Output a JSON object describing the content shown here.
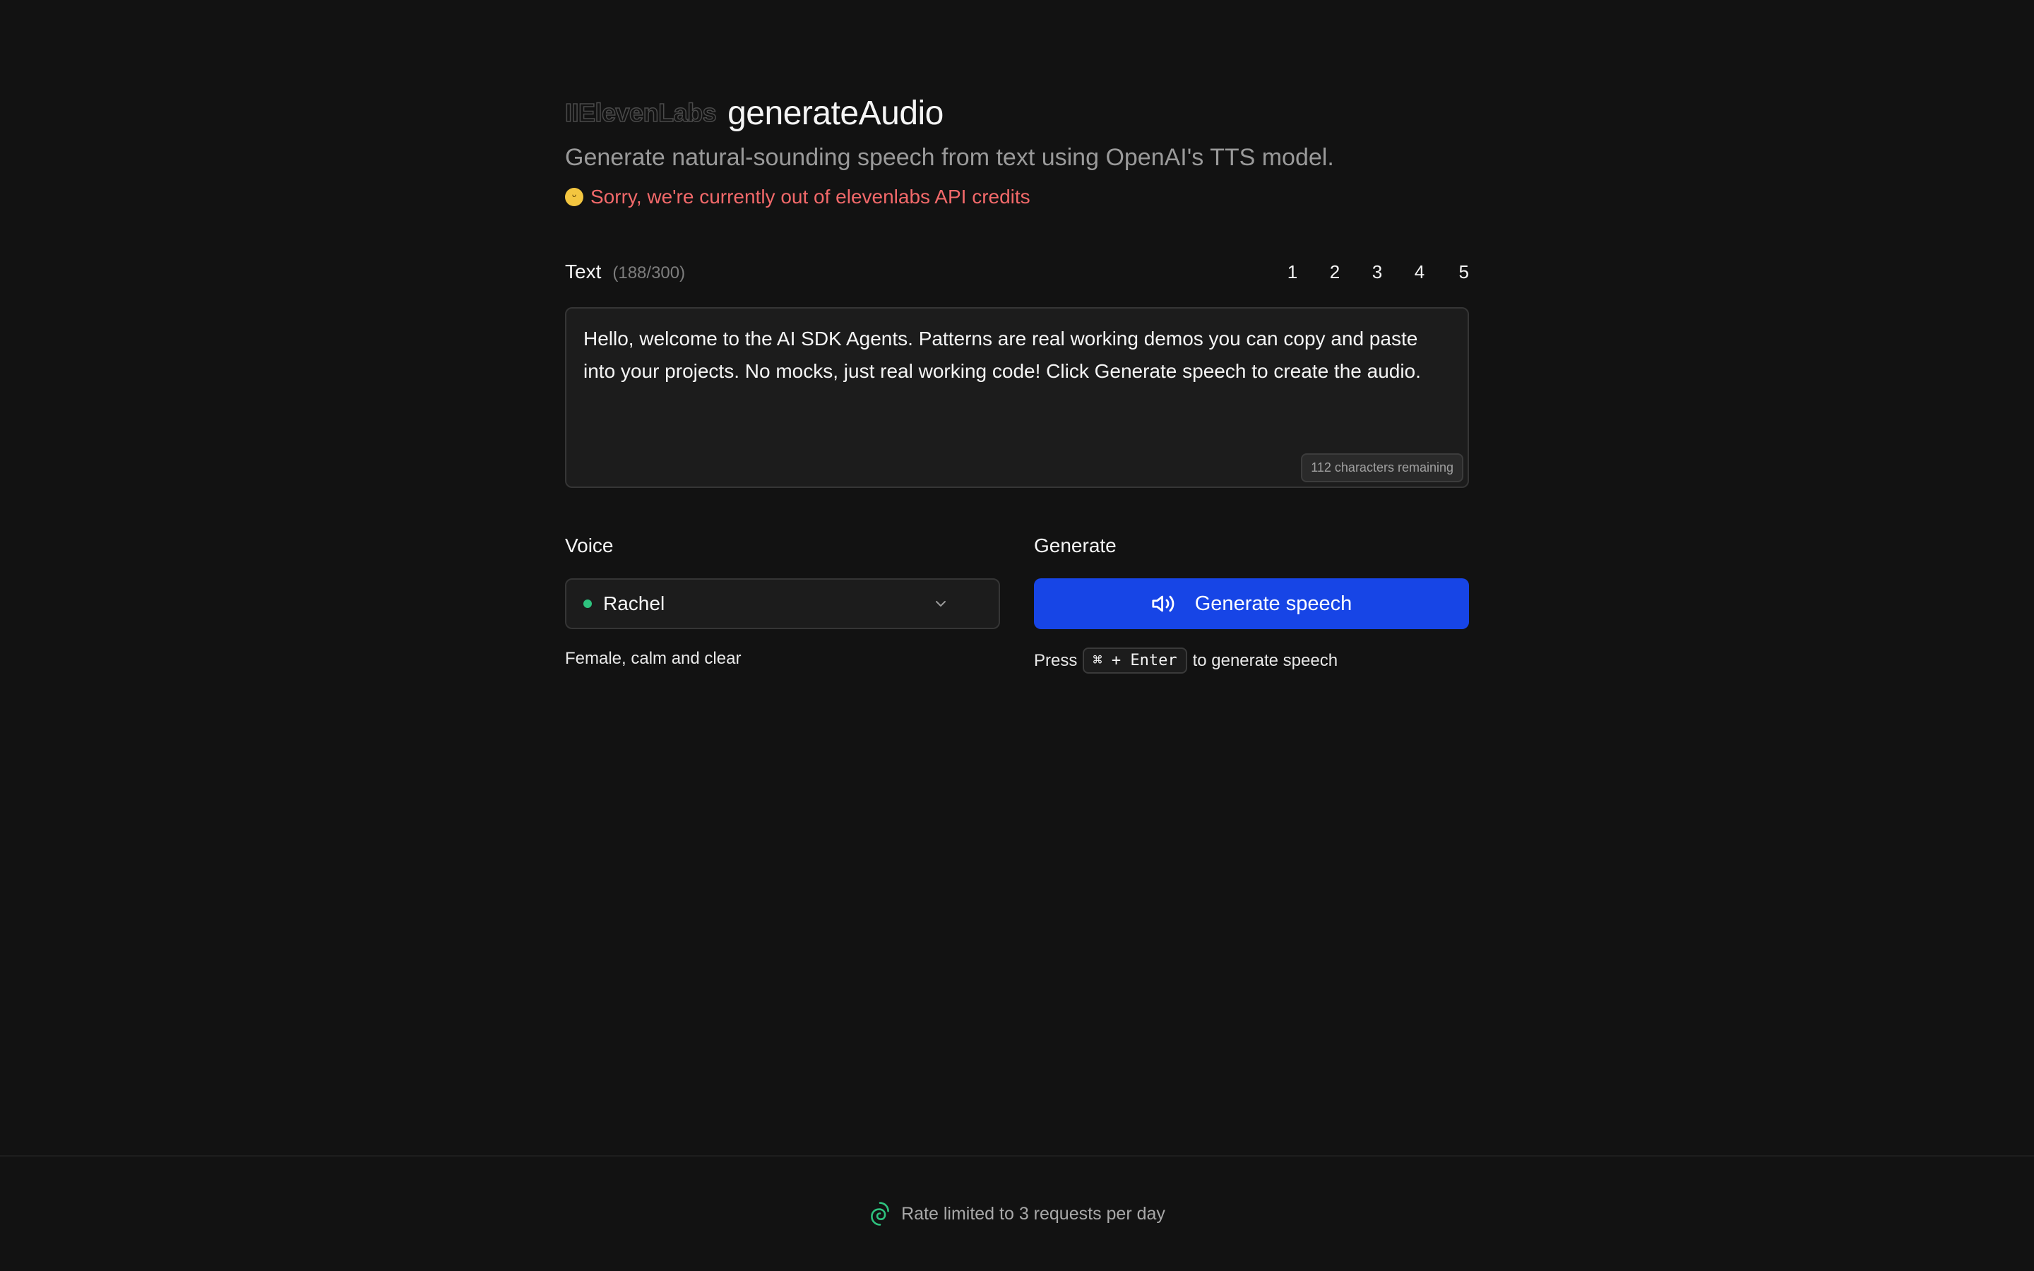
{
  "header": {
    "logo_text": "IIElevenLabs",
    "title": "generateAudio",
    "subtitle": "Generate natural-sounding speech from text using OpenAI's TTS model.",
    "notice": "Sorry, we're currently out of elevenlabs API credits",
    "notice_color": "#f2696a"
  },
  "text_section": {
    "label": "Text",
    "count": "(188/300)",
    "presets": [
      "1",
      "2",
      "3",
      "4",
      "5"
    ],
    "value": "Hello, welcome to the AI SDK Agents. Patterns are real working demos you can copy and paste into your projects. No mocks, just real working code! Click Generate speech to create the audio.",
    "remaining": "112 characters remaining"
  },
  "voice": {
    "label": "Voice",
    "selected": "Rachel",
    "description": "Female, calm and clear",
    "status_color": "#2ec27e"
  },
  "generate": {
    "label": "Generate",
    "button_label": "Generate speech",
    "button_color": "#1745e6",
    "hint_prefix": "Press",
    "shortcut": "⌘ + Enter",
    "hint_suffix": "to generate speech"
  },
  "footer": {
    "text": "Rate limited to 3 requests per day",
    "icon": "spiral-icon"
  }
}
